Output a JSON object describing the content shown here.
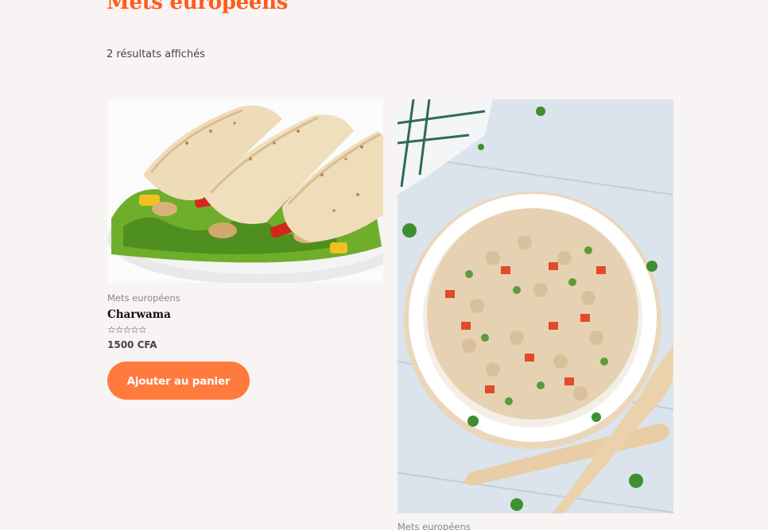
{
  "page": {
    "title": "Mets européens",
    "result_count": "2 résultats affichés"
  },
  "colors": {
    "accent": "#ff5b1a",
    "button": "#ff7a3d",
    "background": "#f8f4f3"
  },
  "products": [
    {
      "image_alt": "wrap-photo",
      "category": "Mets européens",
      "name": "Charwama",
      "rating_stars": "☆☆☆☆☆",
      "price": "1500 CFA",
      "button_label": "Ajouter au panier"
    },
    {
      "image_alt": "pasta-salad-photo",
      "category": "Mets européens"
    }
  ]
}
